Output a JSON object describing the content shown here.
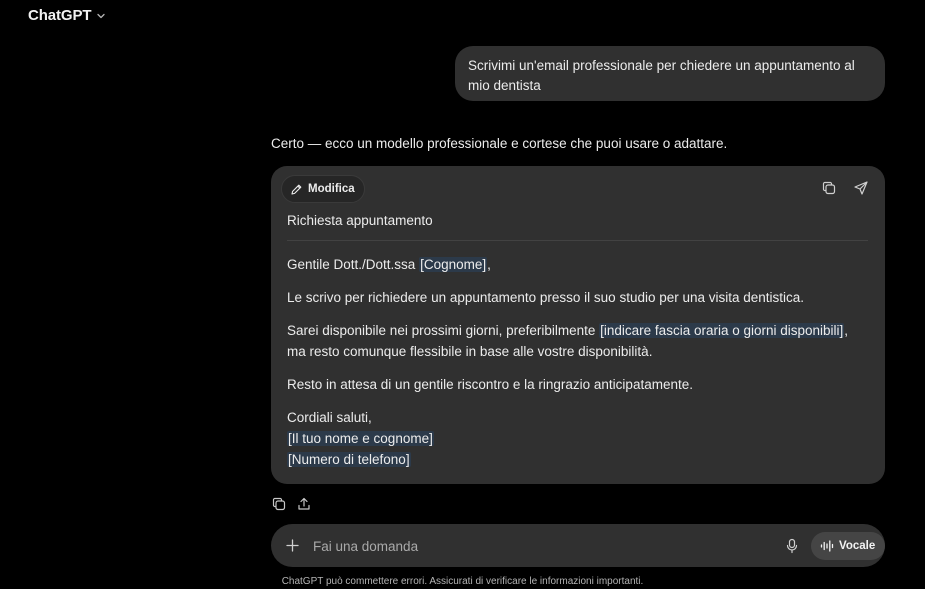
{
  "header": {
    "title": "ChatGPT"
  },
  "user_message": "Scrivimi un'email professionale per chiedere un appuntamento al mio dentista",
  "assistant": {
    "intro": "Certo — ecco un modello professionale e cortese che puoi usare o adattare.",
    "card": {
      "edit_label": "Modifica",
      "subject": "Richiesta appuntamento",
      "greeting": "Gentile Dott./Dott.ssa ",
      "surname_placeholder": "[Cognome]",
      "greeting_end": ",",
      "paragraph1": "Le scrivo per richiedere un appuntamento presso il suo studio per una visita dentistica.",
      "paragraph2_start": "Sarei disponibile nei prossimi giorni, preferibilmente ",
      "availability_placeholder": "[indicare fascia oraria o giorni disponibili]",
      "paragraph2_end": ", ma resto comunque flessibile in base alle vostre disponibilità.",
      "paragraph3": "Resto in attesa di un gentile riscontro e la ringrazio anticipatamente.",
      "closing": "Cordiali saluti,",
      "name_placeholder": "[Il tuo nome e cognome]",
      "phone_placeholder": "[Numero di telefono]"
    }
  },
  "composer": {
    "placeholder": "Fai una domanda",
    "voice_label": "Vocale"
  },
  "disclaimer": "ChatGPT può commettere errori. Assicurati di verificare le informazioni importanti.",
  "colors": {
    "background": "#000000",
    "bubble": "#303030",
    "placeholder_highlight": "#2c3a4a",
    "voice_button": "#454545"
  }
}
